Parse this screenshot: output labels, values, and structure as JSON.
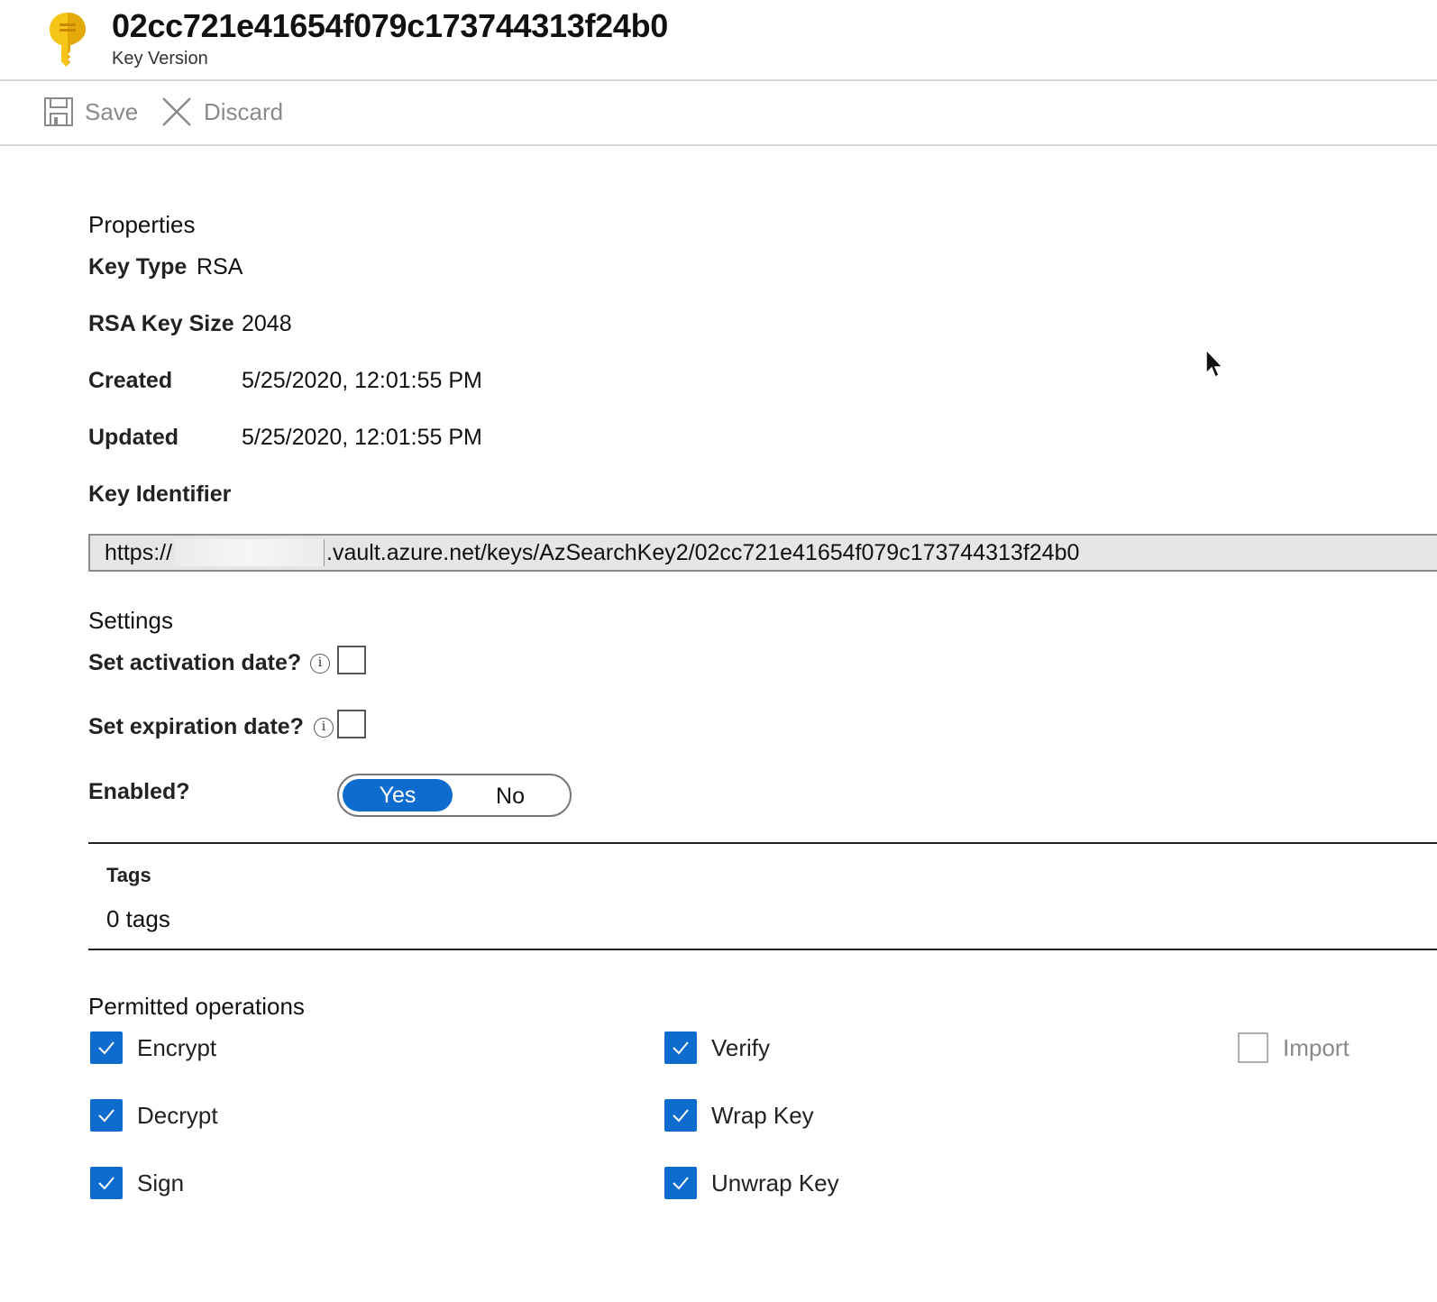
{
  "header": {
    "title": "02cc721e41654f079c173744313f24b0",
    "subtitle": "Key Version",
    "icon": "key-icon"
  },
  "toolbar": {
    "save_label": "Save",
    "discard_label": "Discard"
  },
  "properties": {
    "heading": "Properties",
    "key_type_label": "Key Type",
    "key_type_value": "RSA",
    "key_size_label": "RSA Key Size",
    "key_size_value": "2048",
    "created_label": "Created",
    "created_value": "5/25/2020, 12:01:55 PM",
    "updated_label": "Updated",
    "updated_value": "5/25/2020, 12:01:55 PM",
    "identifier_label": "Key Identifier",
    "identifier_prefix": "https://",
    "identifier_suffix": ".vault.azure.net/keys/AzSearchKey2/02cc721e41654f079c173744313f24b0"
  },
  "settings": {
    "heading": "Settings",
    "activation_label": "Set activation date?",
    "activation_checked": false,
    "expiration_label": "Set expiration date?",
    "expiration_checked": false,
    "enabled_label": "Enabled?",
    "enabled_yes": "Yes",
    "enabled_no": "No",
    "enabled_selected": "Yes"
  },
  "tags": {
    "label": "Tags",
    "value": "0 tags"
  },
  "operations": {
    "heading": "Permitted operations",
    "items": [
      {
        "label": "Encrypt",
        "checked": true
      },
      {
        "label": "Decrypt",
        "checked": true
      },
      {
        "label": "Sign",
        "checked": true
      },
      {
        "label": "Verify",
        "checked": true
      },
      {
        "label": "Wrap Key",
        "checked": true
      },
      {
        "label": "Unwrap Key",
        "checked": true
      },
      {
        "label": "Import",
        "checked": false
      }
    ]
  },
  "colors": {
    "accent": "#0f6ccf",
    "key_icon": "#f5c518"
  }
}
